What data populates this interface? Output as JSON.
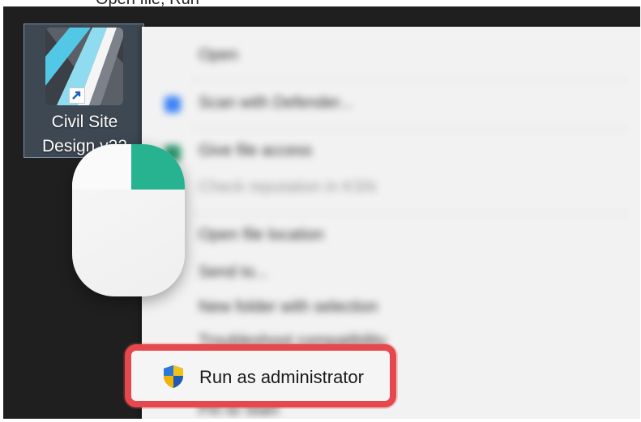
{
  "desktop": {
    "top_clip_text": "Open file, Run",
    "shortcut": {
      "label_line1": "Civil Site",
      "label_line2": "Design v22",
      "icon": "civil-site-design-app-icon"
    }
  },
  "context_menu": {
    "items": [
      {
        "label": "Open",
        "icon": "none",
        "faded": false
      },
      {
        "label": "Scan with Defender...",
        "icon": "defender-icon",
        "faded": false
      },
      {
        "label": "Give file access",
        "icon": "share-icon",
        "faded": false
      },
      {
        "label": "Check reputation in KSN",
        "icon": "none",
        "faded": true
      },
      {
        "label": "Open file location",
        "icon": "none",
        "faded": false
      },
      {
        "label": "Send to...",
        "icon": "none",
        "faded": false
      },
      {
        "label": "New folder with selection",
        "icon": "none",
        "faded": false
      },
      {
        "label": "Troubleshoot compatibility",
        "icon": "none",
        "faded": false
      },
      {
        "label": "Pin to Start",
        "icon": "none",
        "faded": false
      }
    ],
    "highlighted_item": {
      "label": "Run as administrator",
      "icon": "uac-shield-icon",
      "highlight_color": "#e5484d"
    }
  },
  "overlay": {
    "icon": "mouse-right-click-icon",
    "accent": "#27b38f"
  }
}
